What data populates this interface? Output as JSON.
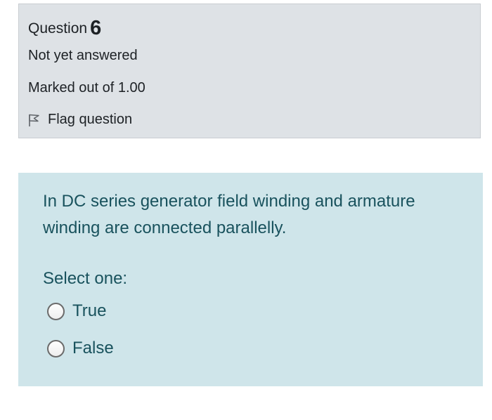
{
  "question": {
    "label": "Question",
    "number": "6",
    "status": "Not yet answered",
    "marks": "Marked out of 1.00",
    "flag_label": "Flag question",
    "flag_icon": "flag-icon"
  },
  "content": {
    "text": "In DC series generator field winding and armature winding are connected parallelly.",
    "select_prompt": "Select one:",
    "options": [
      {
        "label": "True",
        "selected": false
      },
      {
        "label": "False",
        "selected": false
      }
    ]
  },
  "colors": {
    "info_bg": "#dee2e6",
    "content_bg": "#cfe5ea",
    "content_text": "#19525d"
  }
}
